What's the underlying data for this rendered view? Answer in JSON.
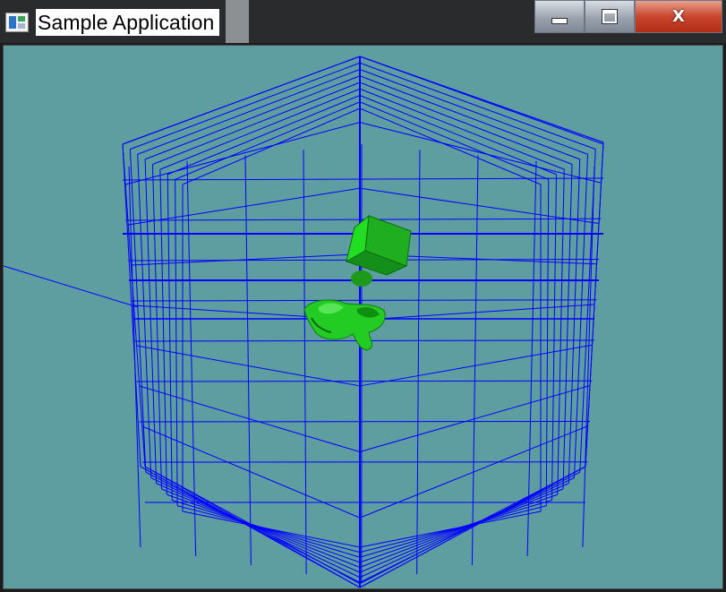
{
  "window": {
    "title": "Sample Application",
    "icon": "application-window-icon",
    "controls": {
      "minimize": "minimize-icon",
      "maximize": "maximize-icon",
      "close": "close-icon",
      "close_glyph": "X"
    }
  },
  "viewport": {
    "background_color": "#5f9ea0",
    "grid_line_color": "#0000ff",
    "model_color": "#22cc22",
    "scene_objects": [
      "wireframe-voxel-grid",
      "green-cube",
      "green-creature-model",
      "ray-line"
    ]
  }
}
